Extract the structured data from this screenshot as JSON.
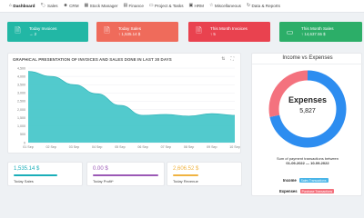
{
  "nav": {
    "items": [
      {
        "label": "Dashboard",
        "icon": "home-icon",
        "glyph": "⌂"
      },
      {
        "label": "Sales",
        "icon": "tag-icon",
        "glyph": "🏷"
      },
      {
        "label": "CRM",
        "icon": "users-icon",
        "glyph": "☻"
      },
      {
        "label": "Stock Manager",
        "icon": "box-icon",
        "glyph": "▦"
      },
      {
        "label": "Finance",
        "icon": "finance-icon",
        "glyph": "▤"
      },
      {
        "label": "Project & Tasks",
        "icon": "folder-icon",
        "glyph": "▭"
      },
      {
        "label": "HRM",
        "icon": "hrm-icon",
        "glyph": "▣"
      },
      {
        "label": "Miscellaneous",
        "icon": "star-icon",
        "glyph": "☆"
      },
      {
        "label": "Data & Reports",
        "icon": "report-icon",
        "glyph": "↻"
      }
    ]
  },
  "cards": [
    {
      "title": "Today Invoices",
      "value": "→ 2",
      "icon": "invoice-icon",
      "glyph": "🗎",
      "color": "#22b7a5"
    },
    {
      "title": "Today Sales",
      "value": "↑ 1,535.14 $",
      "icon": "invoice-icon",
      "glyph": "🗎",
      "color": "#ef6b5b"
    },
    {
      "title": "This Month Invoices",
      "value": "↑ 5",
      "icon": "invoice-icon",
      "glyph": "🗎",
      "color": "#e9424f"
    },
    {
      "title": "This Month Sales",
      "value": "↑ 14,637.55 $",
      "icon": "wallet-icon",
      "glyph": "▭",
      "color": "#2cae68"
    }
  ],
  "chart": {
    "title": "GRAPHICAL PRESENTATION OF INVOICES AND SALES DONE IN LAST 30 DAYS",
    "tools": [
      {
        "icon": "filter-icon",
        "glyph": "⇅"
      },
      {
        "icon": "fullscreen-icon",
        "glyph": "⛶"
      }
    ]
  },
  "chart_data": {
    "type": "area",
    "title": "GRAPHICAL PRESENTATION OF INVOICES AND SALES DONE IN LAST 30 DAYS",
    "categories": [
      "01 Sep",
      "02 Sep",
      "03 Sep",
      "04 Sep",
      "05 Sep",
      "06 Sep",
      "07 Sep",
      "08 Sep",
      "09 Sep",
      "10 Sep"
    ],
    "tick_labels": [
      "01 Sep",
      "02 Sep",
      "03 Sep",
      "04 Sep",
      "05 Sep",
      "06 Sep",
      "07 Sep",
      "08 Sep",
      "09 Sep",
      "10 Sep"
    ],
    "series": [
      {
        "values": [
          4300,
          4000,
          3500,
          2950,
          2250,
          1650,
          1700,
          1600,
          1750,
          1650
        ]
      }
    ],
    "y_ticks": [
      "0",
      "500",
      "1,000",
      "1,500",
      "2,000",
      "2,500",
      "3,000",
      "3,500",
      "4,000",
      "4,500"
    ],
    "ylim": [
      0,
      4500
    ],
    "color": "#3fc4c8",
    "grid": true
  },
  "pie": {
    "title": "Income vs Expenses",
    "center_label": "Expenses",
    "center_value": "5,827",
    "summary_line1": "Sum of payment transactions between",
    "summary_dates": "01-09-2022 — 10-09-2022",
    "legend": [
      {
        "label": "Income",
        "tag": "Sales Transactions",
        "color": "#4ab5e8"
      },
      {
        "label": "Expenses",
        "tag": "Purchase Transactions",
        "color": "#f4717d"
      }
    ],
    "values": [
      {
        "name": "Income",
        "value": 14637.55
      },
      {
        "name": "Expenses",
        "value": 5827
      }
    ],
    "colors": [
      "#2d8df0",
      "#f4727e"
    ]
  },
  "stats": [
    {
      "value": "1,535.14 $",
      "label": "Today Sales",
      "color": "#1aaeb9",
      "fill": 0.7
    },
    {
      "value": "0.00 $",
      "label": "Today Profit*",
      "color": "#9b59b6",
      "fill": 1.0
    },
    {
      "value": "2,606.52 $",
      "label": "Today Revenue",
      "color": "#f0b341",
      "fill": 0.4
    }
  ]
}
